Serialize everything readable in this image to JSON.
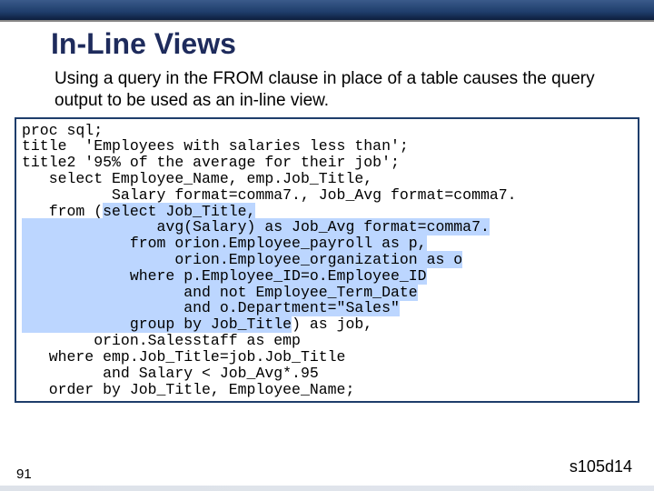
{
  "header": {
    "title": "In-Line Views"
  },
  "desc": "Using a query in the FROM clause in place of a table causes the query output to be used as an in-line view.",
  "code": {
    "l01": "proc sql;",
    "l02": "title  'Employees with salaries less than';",
    "l03": "title2 '95% of the average for their job';",
    "l04": "   select Employee_Name, emp.Job_Title,",
    "l05": "          Salary format=comma7., Job_Avg format=comma7.",
    "l06a": "   from (",
    "l06b": "select Job_Title,",
    "l07": "               avg(Salary) as Job_Avg format=comma7.",
    "l08": "            from orion.Employee_payroll as p,",
    "l09": "                 orion.Employee_organization as o",
    "l10": "            where p.Employee_ID=o.Employee_ID",
    "l11": "                  and not Employee_Term_Date",
    "l12": "                  and o.Department=\"Sales\"",
    "l13a": "            group by Job_Title",
    "l13b": ") as job,",
    "l14": "        orion.Salesstaff as emp",
    "l15": "   where emp.Job_Title=job.Job_Title",
    "l16": "         and Salary < Job_Avg*.95",
    "l17": "   order by Job_Title, Employee_Name;"
  },
  "footer": {
    "page": "91",
    "ref": "s105d14"
  }
}
